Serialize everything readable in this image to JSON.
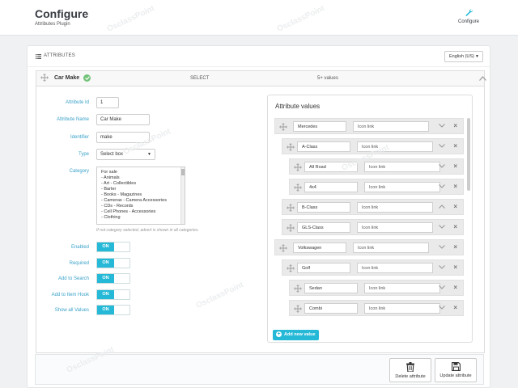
{
  "header": {
    "title": "Configure",
    "subtitle": "Attributes Plugin",
    "configure_label": "Configure"
  },
  "panel": {
    "heading": "ATTRIBUTES",
    "language": "English (US)"
  },
  "attribute": {
    "name": "Car Make",
    "type": "SELECT",
    "value_count": "5+ values"
  },
  "form": {
    "id_label": "Attribute Id",
    "id_value": "1",
    "name_label": "Attribute Name",
    "name_value": "Car Make",
    "identifier_label": "Identifier",
    "identifier_value": "make",
    "type_label": "Type",
    "type_value": "Select box",
    "category_label": "Category",
    "categories": [
      "For sale",
      "- Animals",
      "- Art - Collectibles",
      "- Barter",
      "- Books - Magazines",
      "- Cameras - Camera Accessories",
      "- CDs - Records",
      "- Cell Phones - Accessories",
      "- Clothing"
    ],
    "category_hint": "If not category selected, advert is shown in all categories.",
    "toggles": [
      {
        "label": "Enabled",
        "state": "ON"
      },
      {
        "label": "Required",
        "state": "ON"
      },
      {
        "label": "Add to Search",
        "state": "ON"
      },
      {
        "label": "Add to Item Hook",
        "state": "ON"
      },
      {
        "label": "Show all Values",
        "state": "ON"
      }
    ]
  },
  "values": {
    "title": "Attribute values",
    "icon_placeholder": "Icon link",
    "items": [
      {
        "name": "Mercedes",
        "level": 0,
        "expanded": true
      },
      {
        "name": "A-Class",
        "level": 1,
        "expanded": true
      },
      {
        "name": "All Road",
        "level": 2,
        "expanded": true
      },
      {
        "name": "4x4",
        "level": 2,
        "expanded": true
      },
      {
        "name": "B-Class",
        "level": 1,
        "expanded": false
      },
      {
        "name": "GLS-Class",
        "level": 1,
        "expanded": true
      },
      {
        "name": "Volkswagen",
        "level": 0,
        "expanded": true
      },
      {
        "name": "Golf",
        "level": 1,
        "expanded": true
      },
      {
        "name": "Sedan",
        "level": 2,
        "expanded": true
      },
      {
        "name": "Combi",
        "level": 2,
        "expanded": true
      }
    ],
    "add_label": "Add new value"
  },
  "footer": {
    "delete_label": "Delete attribute",
    "update_label": "Update attribute"
  },
  "watermark_text": "OsclassPoint",
  "colors": {
    "accent": "#25b9d7",
    "label": "#3aa2c9",
    "success": "#72c279"
  }
}
